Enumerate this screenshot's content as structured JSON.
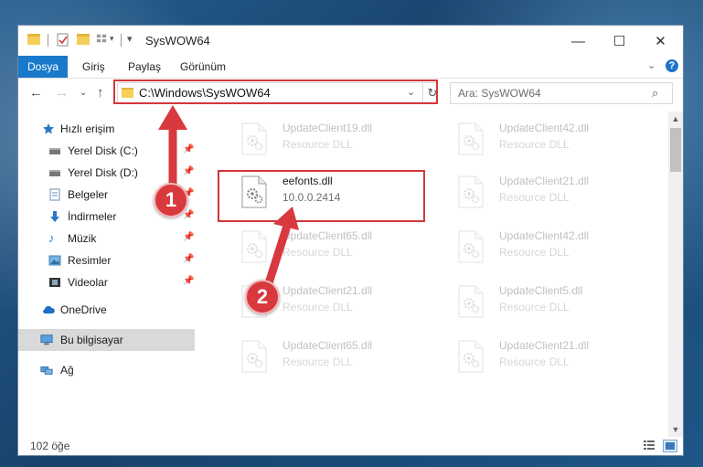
{
  "window": {
    "title": "SysWOW64",
    "controls": {
      "minimize": "—",
      "maximize": "☐",
      "close": "✕"
    }
  },
  "ribbon": {
    "tabs": [
      "Dosya",
      "Giriş",
      "Paylaş",
      "Görünüm"
    ]
  },
  "nav": {
    "address": "C:\\Windows\\SysWOW64",
    "search_placeholder": "Ara: SysWOW64"
  },
  "sidebar": {
    "quick_access": "Hızlı erişim",
    "items": [
      {
        "label": "Yerel Disk (C:)",
        "pinned": true
      },
      {
        "label": "Yerel Disk (D:)",
        "pinned": true
      },
      {
        "label": "Belgeler",
        "pinned": true
      },
      {
        "label": "İndirmeler",
        "pinned": true
      },
      {
        "label": "Müzik",
        "pinned": true
      },
      {
        "label": "Resimler",
        "pinned": true
      },
      {
        "label": "Videolar",
        "pinned": true
      }
    ],
    "onedrive": "OneDrive",
    "this_pc": "Bu bilgisayar",
    "network": "Ağ"
  },
  "files": [
    {
      "name": "UpdateClient19.dll",
      "desc": "Resource DLL",
      "faded": true
    },
    {
      "name": "UpdateClient42.dll",
      "desc": "Resource DLL",
      "faded": true
    },
    {
      "name": "eefonts.dll",
      "desc": "10.0.0.2414",
      "faded": false
    },
    {
      "name": "UpdateClient21.dll",
      "desc": "Resource DLL",
      "faded": true
    },
    {
      "name": "UpdateClient65.dll",
      "desc": "Resource DLL",
      "faded": true
    },
    {
      "name": "UpdateClient42.dll",
      "desc": "Resource DLL",
      "faded": true
    },
    {
      "name": "UpdateClient21.dll",
      "desc": "Resource DLL",
      "faded": true
    },
    {
      "name": "UpdateClient5.dll",
      "desc": "Resource DLL",
      "faded": true
    },
    {
      "name": "UpdateClient65.dll",
      "desc": "Resource DLL",
      "faded": true
    },
    {
      "name": "UpdateClient21.dll",
      "desc": "Resource DLL",
      "faded": true
    }
  ],
  "status": {
    "count": "102 öğe"
  },
  "annotations": {
    "step1": "1",
    "step2": "2"
  },
  "colors": {
    "accent": "#1979ca",
    "highlight": "#d2373c",
    "badge": "#d8393f"
  }
}
